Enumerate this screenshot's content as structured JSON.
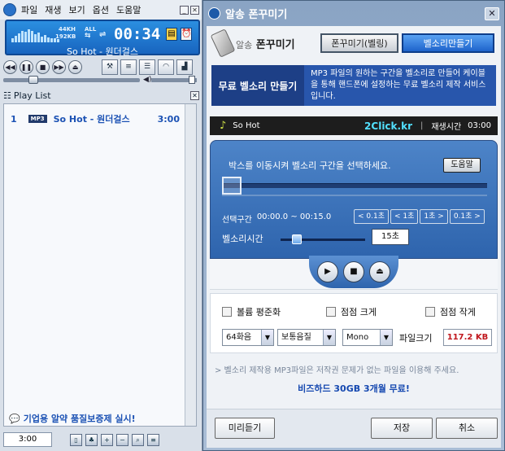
{
  "player": {
    "menu": [
      "파일",
      "재생",
      "보기",
      "옵션",
      "도움말"
    ],
    "bitrate_khz": "44KH",
    "bitrate_kb": "192KB",
    "all": "ALL",
    "time": "00:34",
    "song": "So Hot - 원더걸스",
    "equalizer_levels": [
      0.3,
      0.45,
      0.6,
      0.8,
      0.7,
      0.9,
      0.75,
      0.55,
      0.65,
      0.4,
      0.5,
      0.35,
      0.25,
      0.3,
      0.2
    ],
    "seek_progress": 0.2,
    "volume_level": 0.95
  },
  "playlist": {
    "title": "Play List",
    "items": [
      {
        "num": "1",
        "format": "MP3",
        "title": "So Hot - 원더걸스",
        "duration": "3:00"
      }
    ],
    "ad": "기업용 알약 품질보증제 실시!",
    "time_display": "3:00"
  },
  "window": {
    "title": "알송 폰꾸미기",
    "logo_prefix": "알송",
    "logo_main": "폰꾸미기",
    "tabs": [
      "폰꾸미기(벨링)",
      "벨소리만들기"
    ],
    "promo_label": "무료 벨소리 만들기",
    "promo_text": "MP3 파일의 원하는 구간을 벨소리로 만들어 케이블을 통해 핸드폰에 설정하는 무료 벨소리 제작 서비스입니다."
  },
  "now_playing": {
    "title": "So Hot",
    "site": "2Click.kr",
    "duration_label": "재생시간",
    "duration": "03:00"
  },
  "editor": {
    "instruction": "박스를 이동시켜 벨소리 구간을 선택하세요.",
    "help_button": "도움말",
    "range_label": "선택구간",
    "range_value": "00:00.0 ~ 00:15.0",
    "step_buttons": [
      "< 0.1초",
      "< 1초",
      "1초 >",
      "0.1초 >"
    ],
    "ring_length_label": "벨소리시간",
    "ring_length_value": "15초",
    "ring_length_level": 0.15
  },
  "options": {
    "checkboxes": [
      "볼륨 평준화",
      "점점 크게",
      "점점 작게"
    ],
    "quality": "64화음",
    "sound": "보통음질",
    "channel": "Mono",
    "filesize_label": "파일크기",
    "filesize_value": "117.2 KB"
  },
  "notice": "> 벨소리 제작용 MP3파일은 저작권 문제가 없는 파일을 이용해 주세요.",
  "promo2": "비즈하드 30GB 3개월 무료!",
  "footer": {
    "preview": "미리듣기",
    "save": "저장",
    "cancel": "취소"
  }
}
